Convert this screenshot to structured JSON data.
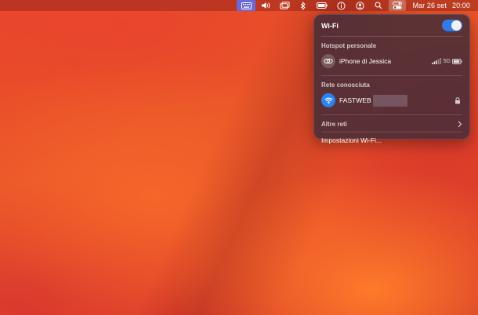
{
  "menubar": {
    "date": "Mar 26 set",
    "time": "20:00",
    "icons": [
      "keyboard-icon",
      "volume-icon",
      "screen-mirroring-icon",
      "bluetooth-icon",
      "battery-icon",
      "info-icon",
      "user-icon",
      "search-icon",
      "control-center-icon"
    ]
  },
  "wifi_panel": {
    "title": "Wi-Fi",
    "toggle_on": true,
    "accent_color": "#2f7bea",
    "hotspot": {
      "section_label": "Hotspot personale",
      "name": "iPhone di Jessica",
      "band": "5G",
      "icon": "hotspot-link-icon"
    },
    "known": {
      "section_label": "Rete conosciuta",
      "name": "FASTWEB",
      "icon": "wifi-icon",
      "locked": true
    },
    "other_networks_label": "Altre reti",
    "settings_label": "Impostazioni Wi-Fi..."
  }
}
